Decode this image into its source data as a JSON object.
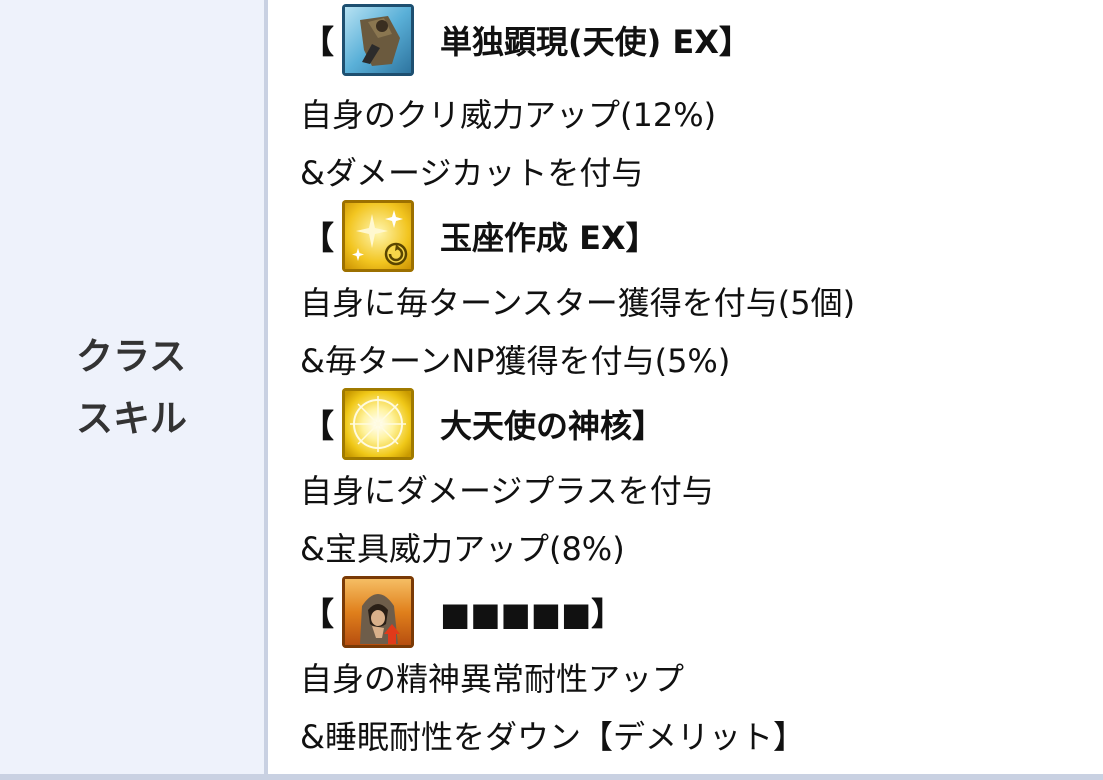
{
  "header": {
    "line1": "クラス",
    "line2": "スキル"
  },
  "skills": [
    {
      "bracket_open": "【",
      "icon": "hooded-figure-dash-icon",
      "name": "単独顕現(天使) EX】",
      "desc_line1": "自身のクリ威力アップ(12%)",
      "desc_line2": "&ダメージカットを付与"
    },
    {
      "bracket_open": "【",
      "icon": "sparkle-stars-icon",
      "name": "玉座作成 EX】",
      "desc_line1": "自身に毎ターンスター獲得を付与(5個)",
      "desc_line2": "&毎ターンNP獲得を付与(5%)"
    },
    {
      "bracket_open": "【",
      "icon": "radiant-light-icon",
      "name": "大天使の神核】",
      "desc_line1": "自身にダメージプラスを付与",
      "desc_line2": "&宝具威力アップ(8%)"
    },
    {
      "bracket_open": "【",
      "icon": "hooded-thinker-icon",
      "name": "■■■■■】",
      "desc_line1": "自身の精神異常耐性アップ",
      "desc_line2": "&睡眠耐性をダウン【デメリット】"
    }
  ],
  "colors": {
    "header_bg": "#eef2fb",
    "border": "#c9d1e2",
    "text": "#111111"
  }
}
